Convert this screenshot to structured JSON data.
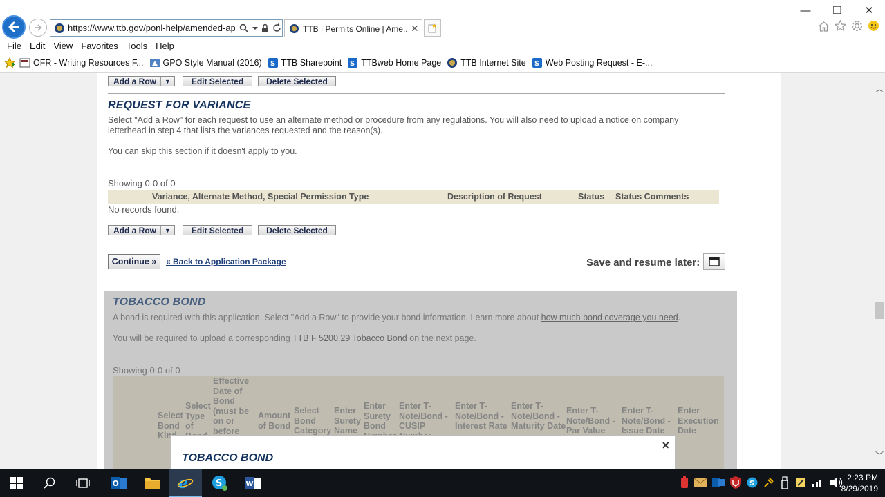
{
  "browser": {
    "url": "https://www.ttb.gov/ponl-help/amended-app",
    "tab_title": "TTB | Permits Online | Ame...",
    "menu": [
      "File",
      "Edit",
      "View",
      "Favorites",
      "Tools",
      "Help"
    ],
    "favorites": [
      {
        "label": "OFR - Writing Resources F...",
        "icon": "ofr-icon"
      },
      {
        "label": "GPO Style Manual (2016)",
        "icon": "gpo-icon"
      },
      {
        "label": "TTB Sharepoint",
        "icon": "sharepoint-icon"
      },
      {
        "label": "TTBweb Home Page",
        "icon": "sharepoint-icon"
      },
      {
        "label": "TTB Internet Site",
        "icon": "ttb-seal-icon"
      },
      {
        "label": "Web Posting Request - E-...",
        "icon": "sharepoint-icon"
      }
    ]
  },
  "top_toolbar": {
    "add_row": "Add a Row",
    "edit_selected": "Edit Selected",
    "delete_selected": "Delete Selected"
  },
  "variance": {
    "title": "REQUEST FOR VARIANCE",
    "description": "Select \"Add a Row\" for each request to use an alternate method or procedure from any regulations. You will also need to upload a notice on company letterhead in step 4 that lists the variances requested and the reason(s).",
    "skip_note": "You can skip this section if it doesn't apply to you.",
    "showing": "Showing 0-0 of 0",
    "columns": [
      "Variance, Alternate Method, Special Permission Type",
      "Description of Request",
      "Status",
      "Status Comments"
    ],
    "empty": "No records found.",
    "toolbar": {
      "add_row": "Add a Row",
      "edit_selected": "Edit Selected",
      "delete_selected": "Delete Selected"
    }
  },
  "actions": {
    "continue": "Continue »",
    "back": "« Back to Application Package",
    "save_resume": "Save and resume later:"
  },
  "tobacco_bond": {
    "title": "TOBACCO BOND",
    "description_pre": "A bond is required with this application. Select \"Add a Row\" to provide your bond information. Learn more about ",
    "description_link": "how much bond coverage you need",
    "description_post": ".",
    "upload_pre": "You will be required to upload a corresponding ",
    "upload_link": "TTB F 5200.29 Tobacco Bond",
    "upload_post": " on the next page.",
    "showing": "Showing 0-0 of 0",
    "columns": [
      "Select Bond Kind",
      "Select Type of Bond",
      "Effective Date of Bond (must be on or before",
      "Amount of Bond",
      "Select Bond Category",
      "Enter Surety Name",
      "Enter Surety Bond Number",
      "Enter T-Note/Bond - CUSIP Number",
      "Enter T-Note/Bond - Interest Rate",
      "Enter T-Note/Bond - Maturity Date",
      "Enter T-Note/Bond - Par Value",
      "Enter T-Note/Bond - Issue Date",
      "Enter Execution Date"
    ]
  },
  "modal": {
    "title": "TOBACCO BOND",
    "close": "×"
  },
  "taskbar": {
    "time": "2:23 PM",
    "date": "8/29/2019"
  }
}
